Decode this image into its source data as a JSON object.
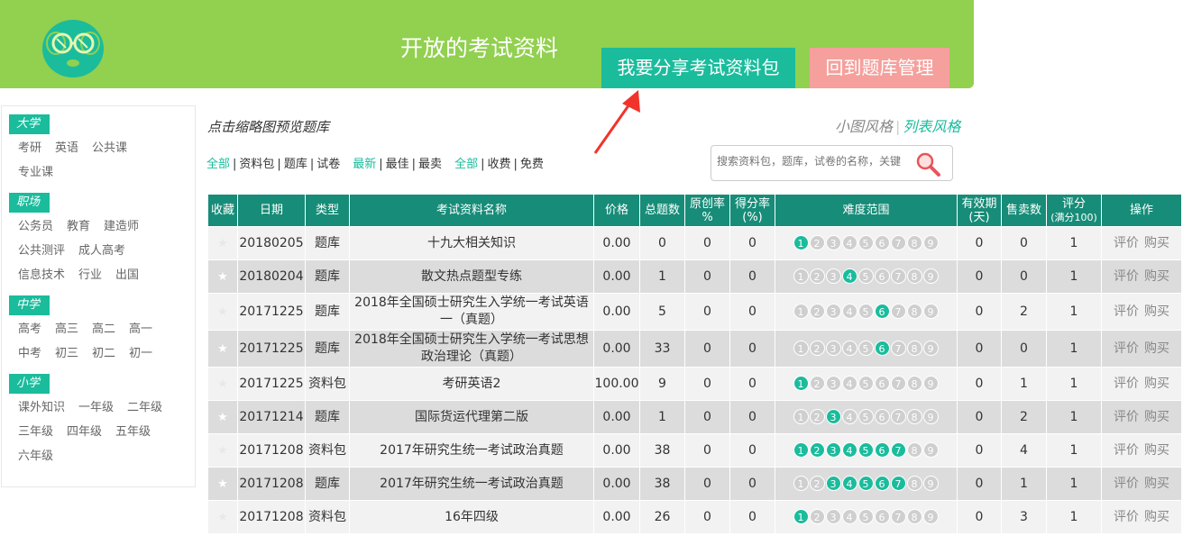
{
  "header": {
    "title": "开放的考试资料",
    "share_button": "我要分享考试资料包",
    "back_button": "回到题库管理",
    "colors": {
      "header_bg": "#92d050",
      "accent": "#1abc9c",
      "back_btn": "#f5a09c"
    }
  },
  "sidebar": [
    {
      "title": "大学",
      "items": [
        "考研",
        "英语",
        "公共课",
        "专业课"
      ]
    },
    {
      "title": "职场",
      "items": [
        "公务员",
        "教育",
        "建造师",
        "公共测评",
        "成人高考",
        "信息技术",
        "行业",
        "出国"
      ]
    },
    {
      "title": "中学",
      "items": [
        "高考",
        "高三",
        "高二",
        "高一",
        "中考",
        "初三",
        "初二",
        "初一"
      ]
    },
    {
      "title": "小学",
      "items": [
        "课外知识",
        "一年级",
        "二年级",
        "三年级",
        "四年级",
        "五年级",
        "六年级"
      ]
    }
  ],
  "hint": "点击缩略图预览题库",
  "view": {
    "small": "小图风格",
    "list": "列表风格"
  },
  "filters": {
    "group1": [
      "全部",
      "资料包",
      "题库",
      "试卷"
    ],
    "group2": [
      "最新",
      "最佳",
      "最卖"
    ],
    "group3": [
      "全部",
      "收费",
      "免费"
    ]
  },
  "search": {
    "placeholder": "搜索资料包，题库，试卷的名称，关键"
  },
  "table": {
    "headers": {
      "fav": "收藏",
      "date": "日期",
      "type": "类型",
      "name": "考试资料名称",
      "price": "价格",
      "total": "总题数",
      "orig_1": "原创率",
      "orig_2": "%",
      "score_1": "得分率",
      "score_2": "(%)",
      "diff": "难度范围",
      "valid_1": "有效期",
      "valid_2": "(天)",
      "sold": "售卖数",
      "rating_1": "评分",
      "rating_2": "(满分100)",
      "ops": "操作"
    },
    "op_labels": [
      "评价",
      "购买"
    ],
    "rows": [
      {
        "date": "20180205",
        "type": "题库",
        "name": "十九大相关知识",
        "price": "0.00",
        "total": "0",
        "orig": "0",
        "score": "0",
        "diff": [
          1
        ],
        "valid": "0",
        "sold": "0",
        "rating": "1"
      },
      {
        "date": "20180204",
        "type": "题库",
        "name": "散文热点题型专练",
        "price": "0.00",
        "total": "1",
        "orig": "0",
        "score": "0",
        "diff": [
          4
        ],
        "valid": "0",
        "sold": "0",
        "rating": "1"
      },
      {
        "date": "20171225",
        "type": "题库",
        "name": "2018年全国硕士研究生入学统一考试英语一（真题）",
        "price": "0.00",
        "total": "5",
        "orig": "0",
        "score": "0",
        "diff": [
          6
        ],
        "valid": "0",
        "sold": "2",
        "rating": "1"
      },
      {
        "date": "20171225",
        "type": "题库",
        "name": "2018年全国硕士研究生入学统一考试思想政治理论（真题）",
        "price": "0.00",
        "total": "33",
        "orig": "0",
        "score": "0",
        "diff": [
          6
        ],
        "valid": "0",
        "sold": "0",
        "rating": "1"
      },
      {
        "date": "20171225",
        "type": "资料包",
        "name": "考研英语2",
        "price": "100.00",
        "total": "9",
        "orig": "0",
        "score": "0",
        "diff": [
          1
        ],
        "valid": "0",
        "sold": "1",
        "rating": "1"
      },
      {
        "date": "20171214",
        "type": "题库",
        "name": "国际货运代理第二版",
        "price": "0.00",
        "total": "1",
        "orig": "0",
        "score": "0",
        "diff": [
          3
        ],
        "valid": "0",
        "sold": "2",
        "rating": "1"
      },
      {
        "date": "20171208",
        "type": "资料包",
        "name": "2017年研究生统一考试政治真题",
        "price": "0.00",
        "total": "38",
        "orig": "0",
        "score": "0",
        "diff": [
          1,
          2,
          3,
          4,
          5,
          6,
          7
        ],
        "valid": "0",
        "sold": "4",
        "rating": "1"
      },
      {
        "date": "20171208",
        "type": "题库",
        "name": "2017年研究生统一考试政治真题",
        "price": "0.00",
        "total": "38",
        "orig": "0",
        "score": "0",
        "diff": [
          3,
          4,
          5,
          6,
          7
        ],
        "valid": "0",
        "sold": "1",
        "rating": "1"
      },
      {
        "date": "20171208",
        "type": "资料包",
        "name": "16年四级",
        "price": "0.00",
        "total": "26",
        "orig": "0",
        "score": "0",
        "diff": [
          1
        ],
        "valid": "0",
        "sold": "3",
        "rating": "1"
      }
    ]
  }
}
